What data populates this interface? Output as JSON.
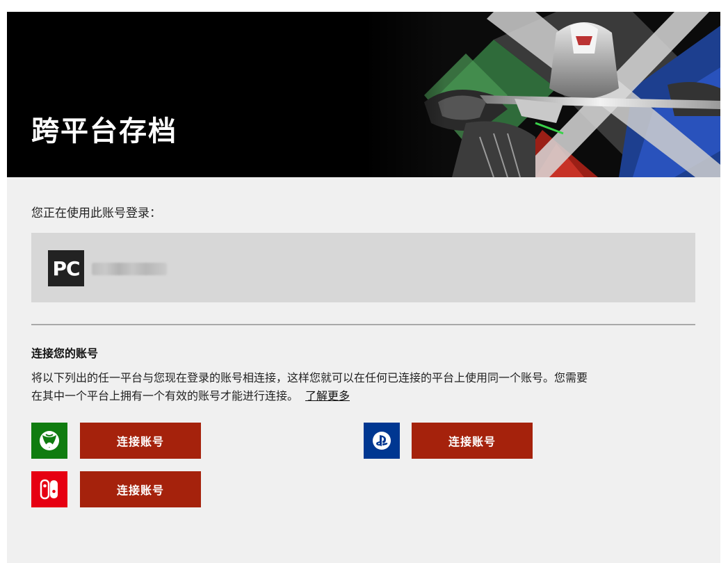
{
  "header": {
    "title": "跨平台存档"
  },
  "account": {
    "signed_in_label": "您正在使用此账号登录：",
    "platform_badge": "PC",
    "username_hidden": true
  },
  "connect": {
    "heading": "连接您的账号",
    "description_line1": "将以下列出的任一平台与您现在登录的账号相连接，这样您就可以在任何已连接的平台上使用同一个账号。您需要",
    "description_line2": "在其中一个平台上拥有一个有效的账号才能进行连接。",
    "learn_more": "了解更多",
    "platforms": [
      {
        "name": "Xbox",
        "icon": "xbox-icon",
        "color": "#107c10",
        "button_label": "连接账号"
      },
      {
        "name": "PlayStation",
        "icon": "playstation-icon",
        "color": "#003791",
        "button_label": "连接账号"
      },
      {
        "name": "Nintendo Switch",
        "icon": "nintendo-switch-icon",
        "color": "#e60012",
        "button_label": "连接账号"
      }
    ]
  },
  "colors": {
    "button": "#a5220c",
    "panel_bg": "#f0f0f0",
    "account_box": "#d7d7d7",
    "header_bg": "#000000"
  }
}
